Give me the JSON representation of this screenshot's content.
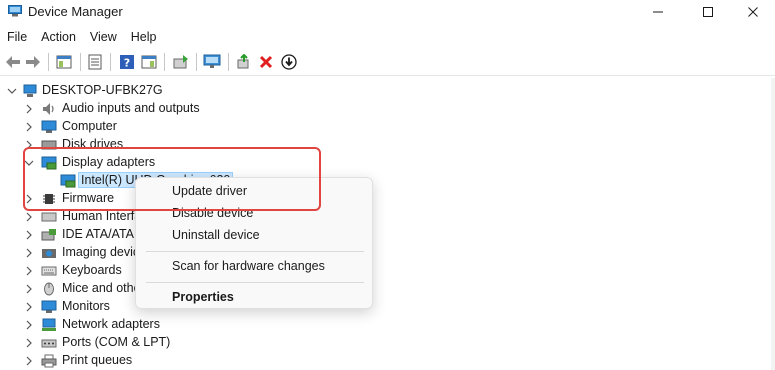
{
  "window": {
    "title": "Device Manager"
  },
  "menu": [
    "File",
    "Action",
    "View",
    "Help"
  ],
  "tree": {
    "root": "DESKTOP-UFBK27G",
    "categories": [
      {
        "label": "Audio inputs and outputs",
        "icon": "speaker-icon"
      },
      {
        "label": "Computer",
        "icon": "monitor-icon"
      },
      {
        "label": "Disk drives",
        "icon": "disk-icon"
      },
      {
        "label": "Display adapters",
        "icon": "display-adapter-icon",
        "expanded": true
      },
      {
        "label": "Firmware",
        "icon": "chip-icon"
      },
      {
        "label": "Human Interface Devices",
        "icon": "hid-icon"
      },
      {
        "label": "IDE ATA/ATAPI controllers",
        "icon": "ide-icon"
      },
      {
        "label": "Imaging devices",
        "icon": "camera-icon"
      },
      {
        "label": "Keyboards",
        "icon": "keyboard-icon"
      },
      {
        "label": "Mice and other pointing devices",
        "icon": "mouse-icon"
      },
      {
        "label": "Monitors",
        "icon": "monitor-icon"
      },
      {
        "label": "Network adapters",
        "icon": "network-icon"
      },
      {
        "label": "Ports (COM & LPT)",
        "icon": "port-icon"
      },
      {
        "label": "Print queues",
        "icon": "printer-icon"
      }
    ],
    "display_child": "Intel(R) UHD Graphics 630"
  },
  "context_menu": {
    "items": [
      "Update driver",
      "Disable device",
      "Uninstall device",
      "Scan for hardware changes",
      "Properties"
    ]
  },
  "colors": {
    "highlight_border": "#e0453f",
    "selection_bg": "#cce8ff"
  }
}
